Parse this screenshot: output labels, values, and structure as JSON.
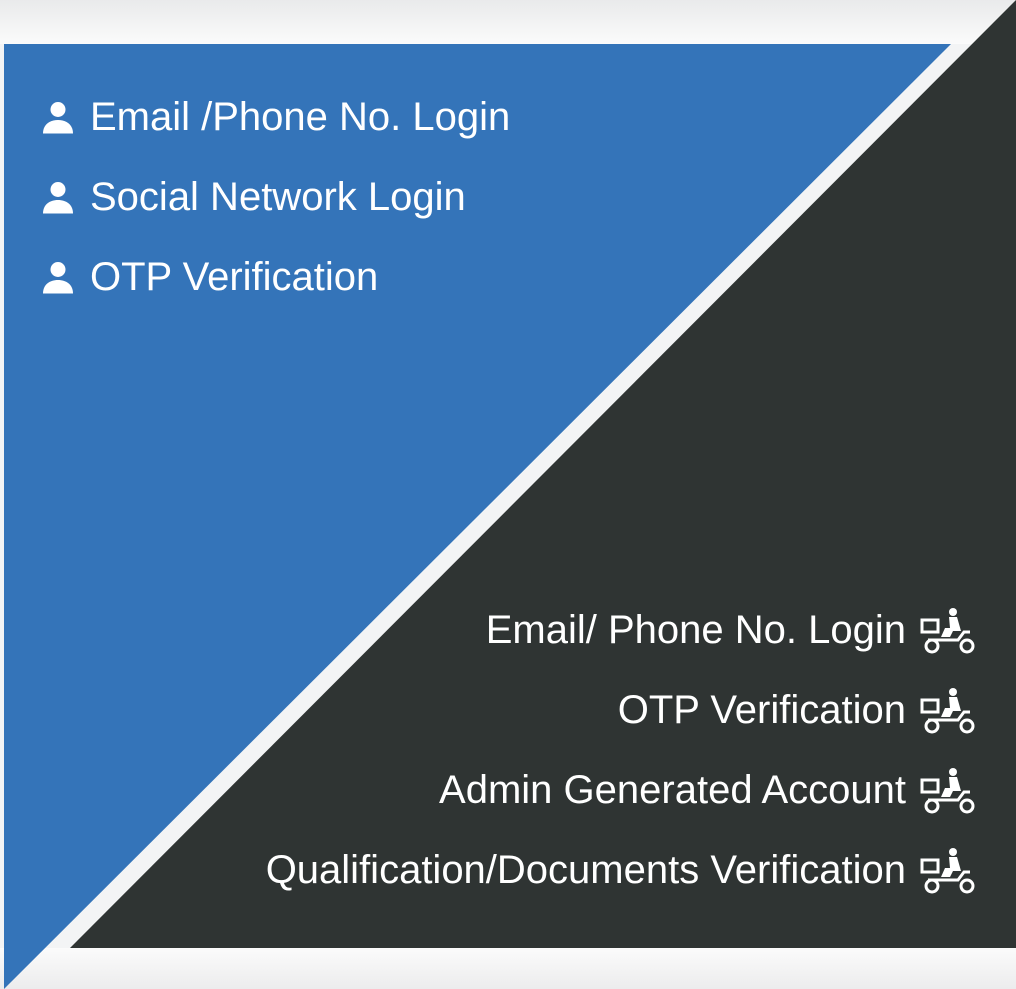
{
  "colors": {
    "user_panel": "#3474b9",
    "driver_panel": "#2f3433",
    "divider": "#f3f4f5",
    "text": "#ffffff"
  },
  "user_features": {
    "icon": "user-icon",
    "items": [
      {
        "label": "Email /Phone No. Login"
      },
      {
        "label": "Social Network Login"
      },
      {
        "label": "OTP Verification"
      }
    ]
  },
  "driver_features": {
    "icon": "delivery-scooter-icon",
    "items": [
      {
        "label": "Email/ Phone No. Login"
      },
      {
        "label": "OTP Verification"
      },
      {
        "label": "Admin Generated Account"
      },
      {
        "label": "Qualification/Documents Verification"
      }
    ]
  }
}
